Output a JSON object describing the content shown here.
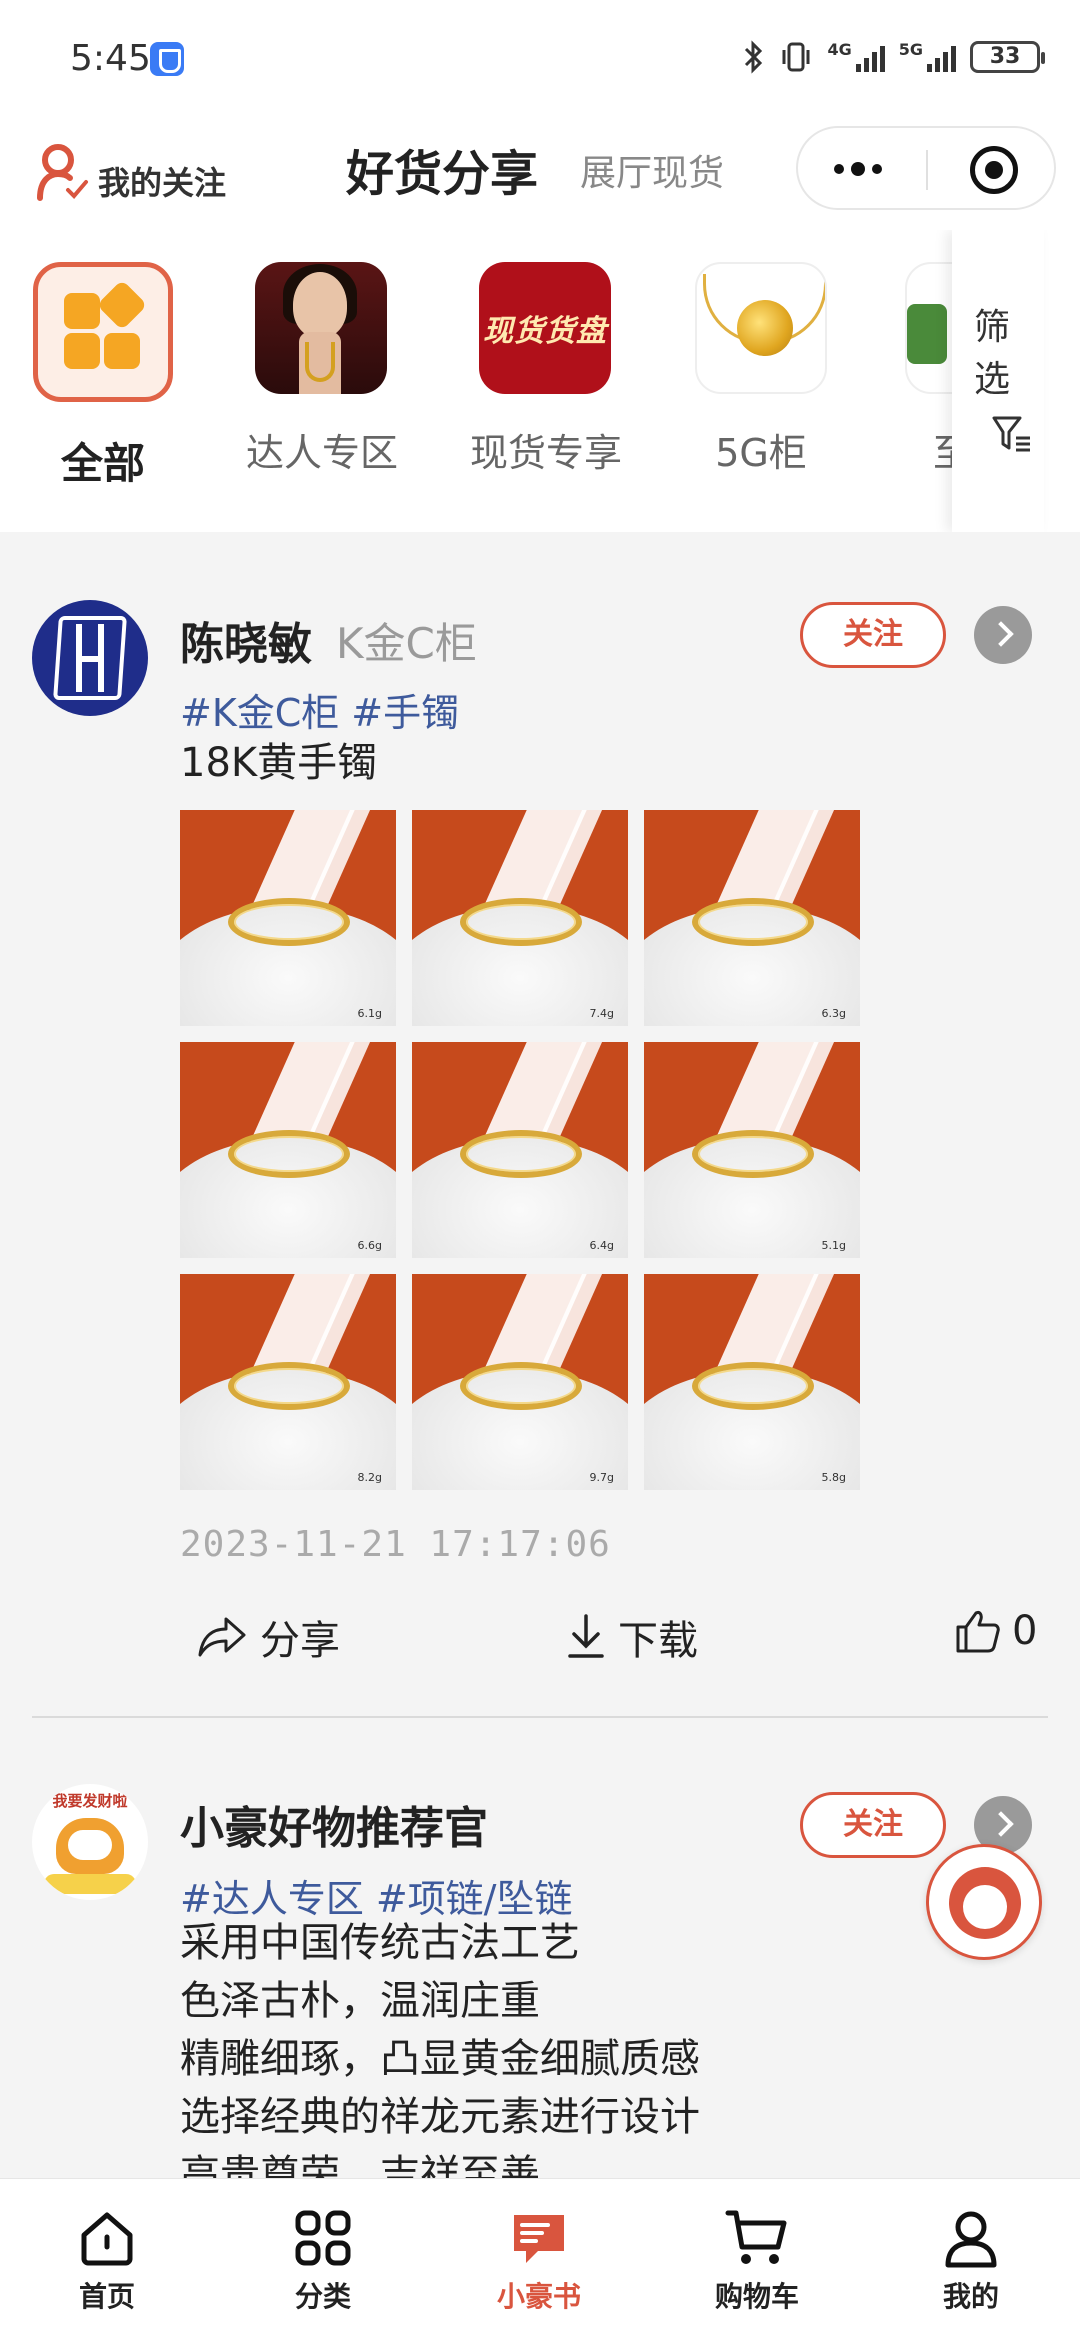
{
  "status_bar": {
    "time": "5:45",
    "battery": "33",
    "net1": "4G",
    "net2": "5G"
  },
  "header": {
    "follow_label": "我的关注",
    "title": "好货分享",
    "subtitle": "展厅现货"
  },
  "categories": [
    {
      "label": "全部",
      "icon": "grid-icon",
      "active": true
    },
    {
      "label": "达人专区",
      "icon": "model-photo"
    },
    {
      "label": "现货专享",
      "icon": "spot-badge",
      "badge_text": "现货货盘"
    },
    {
      "label": "5G柜",
      "icon": "pendant-photo"
    },
    {
      "label": "至尊",
      "icon": "jewelry-photo"
    }
  ],
  "filter": {
    "label": "筛选"
  },
  "posts": [
    {
      "author": "陈晓敏",
      "author_tag": "K金C柜",
      "follow_label": "关注",
      "tags": [
        "#K金C柜",
        "#手镯"
      ],
      "text_lines": [
        "18K黄手镯"
      ],
      "image_weights": [
        "6.1g",
        "7.4g",
        "6.3g",
        "6.6g",
        "6.4g",
        "5.1g",
        "8.2g",
        "9.7g",
        "5.8g"
      ],
      "time": "2023-11-21 17:17:06",
      "actions": {
        "share": "分享",
        "download": "下载",
        "like_count": "0"
      }
    },
    {
      "author": "小豪好物推荐官",
      "avatar_text": "我要发财啦",
      "follow_label": "关注",
      "tags": [
        "#达人专区",
        "#项链/坠链"
      ],
      "text_lines": [
        "采用中国传统古法工艺",
        "色泽古朴，温润庄重",
        "精雕细琢，凸显黄金细腻质感",
        "选择经典的祥龙元素进行设计",
        "高贵尊荣，吉祥至善"
      ]
    }
  ],
  "tabbar": [
    {
      "label": "首页",
      "icon": "home-icon"
    },
    {
      "label": "分类",
      "icon": "category-icon"
    },
    {
      "label": "小豪书",
      "icon": "book-icon",
      "active": true
    },
    {
      "label": "购物车",
      "icon": "cart-icon"
    },
    {
      "label": "我的",
      "icon": "profile-icon"
    }
  ],
  "colors": {
    "accent": "#d9553e",
    "tag": "#3e5a9c",
    "muted": "#9a9a9a"
  }
}
